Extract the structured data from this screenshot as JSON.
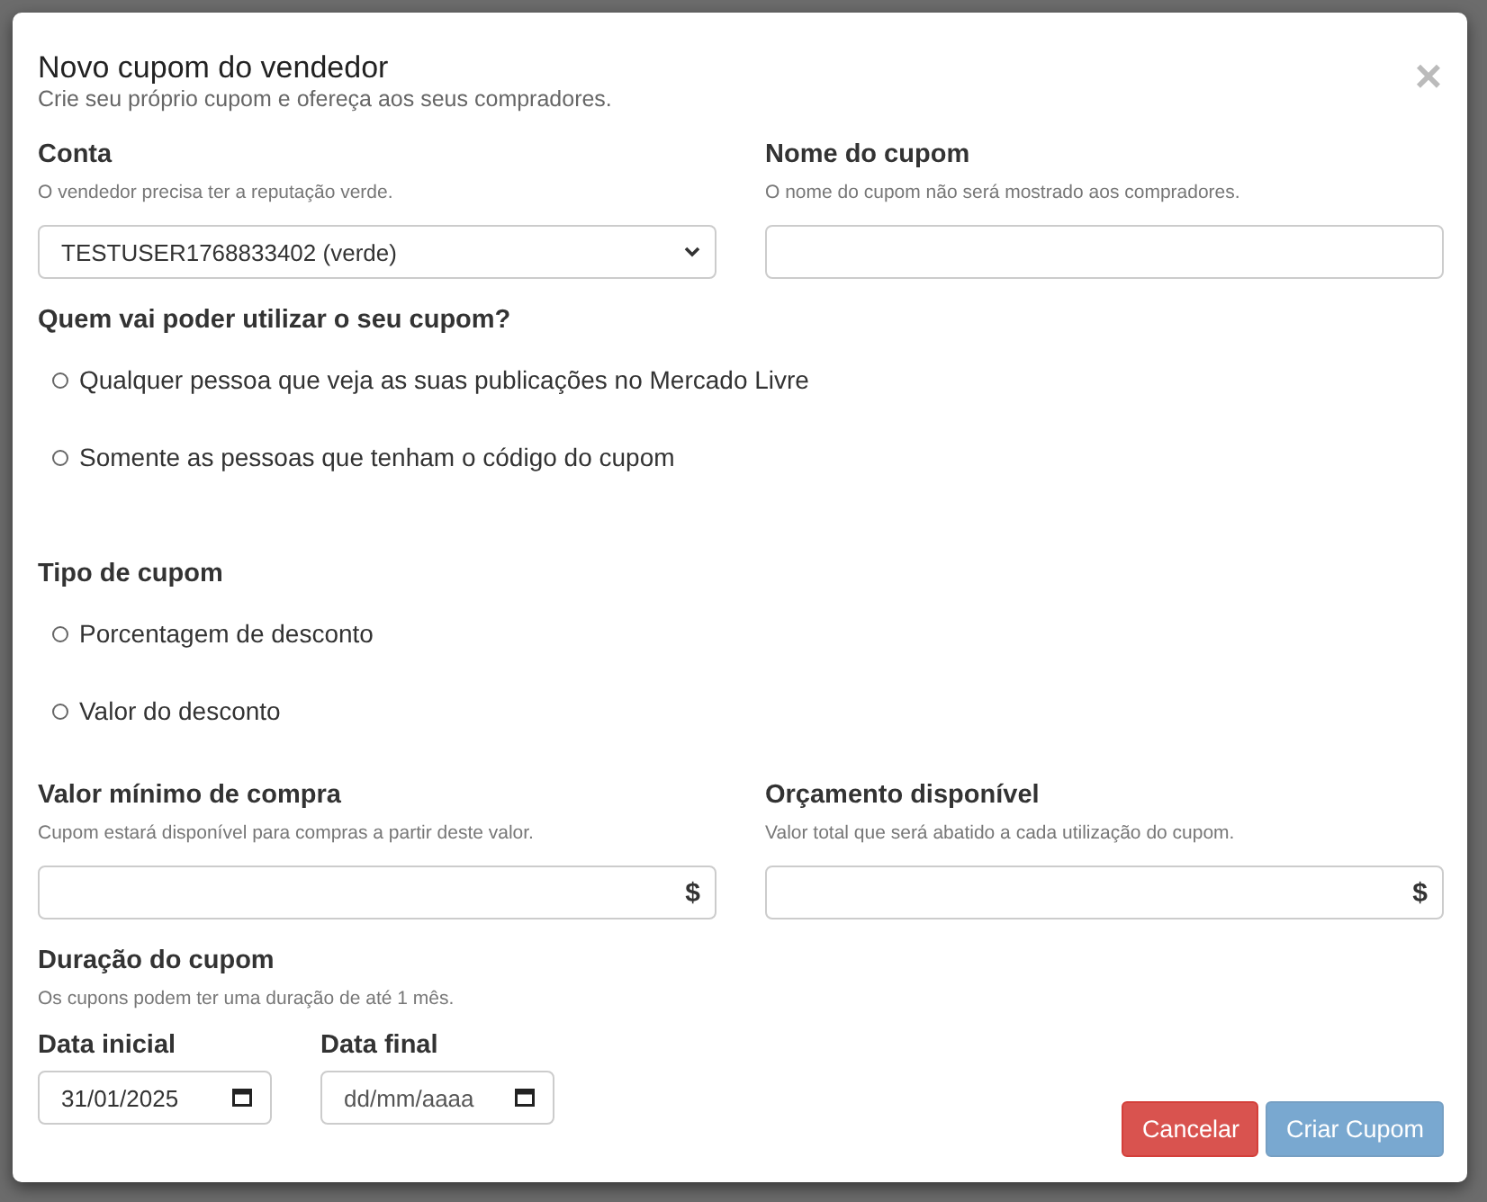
{
  "dialog": {
    "title": "Novo cupom do vendedor",
    "subtitle": "Crie seu próprio cupom e ofereça aos seus compradores.",
    "close": "×"
  },
  "account": {
    "label": "Conta",
    "help": "O vendedor precisa ter a reputação verde.",
    "value": "TESTUSER1768833402 (verde)"
  },
  "coupon_name": {
    "label": "Nome do cupom",
    "help": "O nome do cupom não será mostrado aos compradores."
  },
  "audience": {
    "label": "Quem vai poder utilizar o seu cupom?",
    "options": [
      {
        "label": "Qualquer pessoa que veja as suas publicações no Mercado Livre",
        "selected": false
      },
      {
        "label": "Somente as pessoas que tenham o código do cupom",
        "selected": false
      }
    ]
  },
  "coupon_type": {
    "label": "Tipo de cupom",
    "options": [
      {
        "label": "Porcentagem de desconto",
        "selected": false
      },
      {
        "label": "Valor do desconto",
        "selected": false
      }
    ]
  },
  "min_purchase": {
    "label": "Valor mínimo de compra",
    "help": "Cupom estará disponível para compras a partir deste valor.",
    "suffix": "$"
  },
  "budget": {
    "label": "Orçamento disponível",
    "help": "Valor total que será abatido a cada utilização do cupom.",
    "suffix": "$"
  },
  "duration": {
    "label": "Duração do cupom",
    "help": "Os cupons podem ter uma duração de até 1 mês.",
    "start": {
      "label": "Data inicial",
      "value": "31/01/2025"
    },
    "end": {
      "label": "Data final",
      "placeholder": "dd/mm/aaaa"
    }
  },
  "buttons": [
    {
      "label": "Cancelar",
      "kind": "cancel",
      "disabled": false
    },
    {
      "label": "Criar Cupom",
      "kind": "create",
      "disabled": true
    }
  ]
}
